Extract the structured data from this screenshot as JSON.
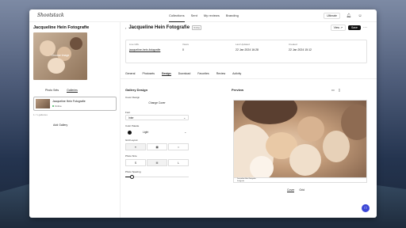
{
  "app": {
    "logo": "Shootstack"
  },
  "topnav": {
    "items": [
      {
        "label": "Collections",
        "active": true
      },
      {
        "label": "Sent",
        "active": false
      },
      {
        "label": "My reviews",
        "active": false
      },
      {
        "label": "Branding",
        "active": false
      }
    ],
    "upgrade_label": "Ultimate"
  },
  "sidebar": {
    "title": "Jacqueline Hein Fotografie",
    "cover_hint": "Choose Image",
    "tabs": [
      {
        "label": "Photo Sets",
        "active": false
      },
      {
        "label": "Galleries",
        "active": true
      }
    ],
    "gallery_item": {
      "name": "Jacqueline Hein Fotografie",
      "status": "Online"
    },
    "gallery_count": "1 / 1 galleries",
    "add_label": "Add Gallery"
  },
  "main": {
    "title": "Jacqueline Hein Fotografie",
    "badge": "Online",
    "view_label": "View",
    "save_label": "Save",
    "info": {
      "live_url_label": "Live URL",
      "live_url_value": "jacqueline-hein-fotografie",
      "views_label": "Views",
      "views_value": "0",
      "updated_label": "Last Updated",
      "updated_value": "22 Jan 2024 16:28",
      "created_label": "Created",
      "created_value": "22 Jan 2024 15:12"
    },
    "tabs": [
      {
        "label": "General",
        "active": false
      },
      {
        "label": "Photosets",
        "active": false
      },
      {
        "label": "Design",
        "active": true
      },
      {
        "label": "Download",
        "active": false
      },
      {
        "label": "Favorites",
        "active": false
      },
      {
        "label": "Review",
        "active": false
      },
      {
        "label": "Activity",
        "active": false
      }
    ]
  },
  "design": {
    "title": "Gallery Design",
    "cover_label": "Cover Design",
    "change_cover": "Change Cover",
    "font_label": "Font",
    "font_value": "Inter",
    "color_label": "Color Palette",
    "color_value": "Light",
    "grid_label": "Grid Layout",
    "size_label": "Photo Size",
    "sizes": [
      "S",
      "M",
      "L"
    ],
    "spacing_label": "Photo Spacing",
    "spacing_level": 0.1
  },
  "preview": {
    "title": "Preview",
    "caption_title": "Jacqueline Hein Fotografie",
    "caption_sub": "Fotografie",
    "tabs": [
      {
        "label": "Cover",
        "active": true
      },
      {
        "label": "Grid",
        "active": false
      }
    ]
  },
  "colors": {
    "accent": "#111111",
    "chat": "#3b46d6",
    "online": "#3bb45a"
  }
}
